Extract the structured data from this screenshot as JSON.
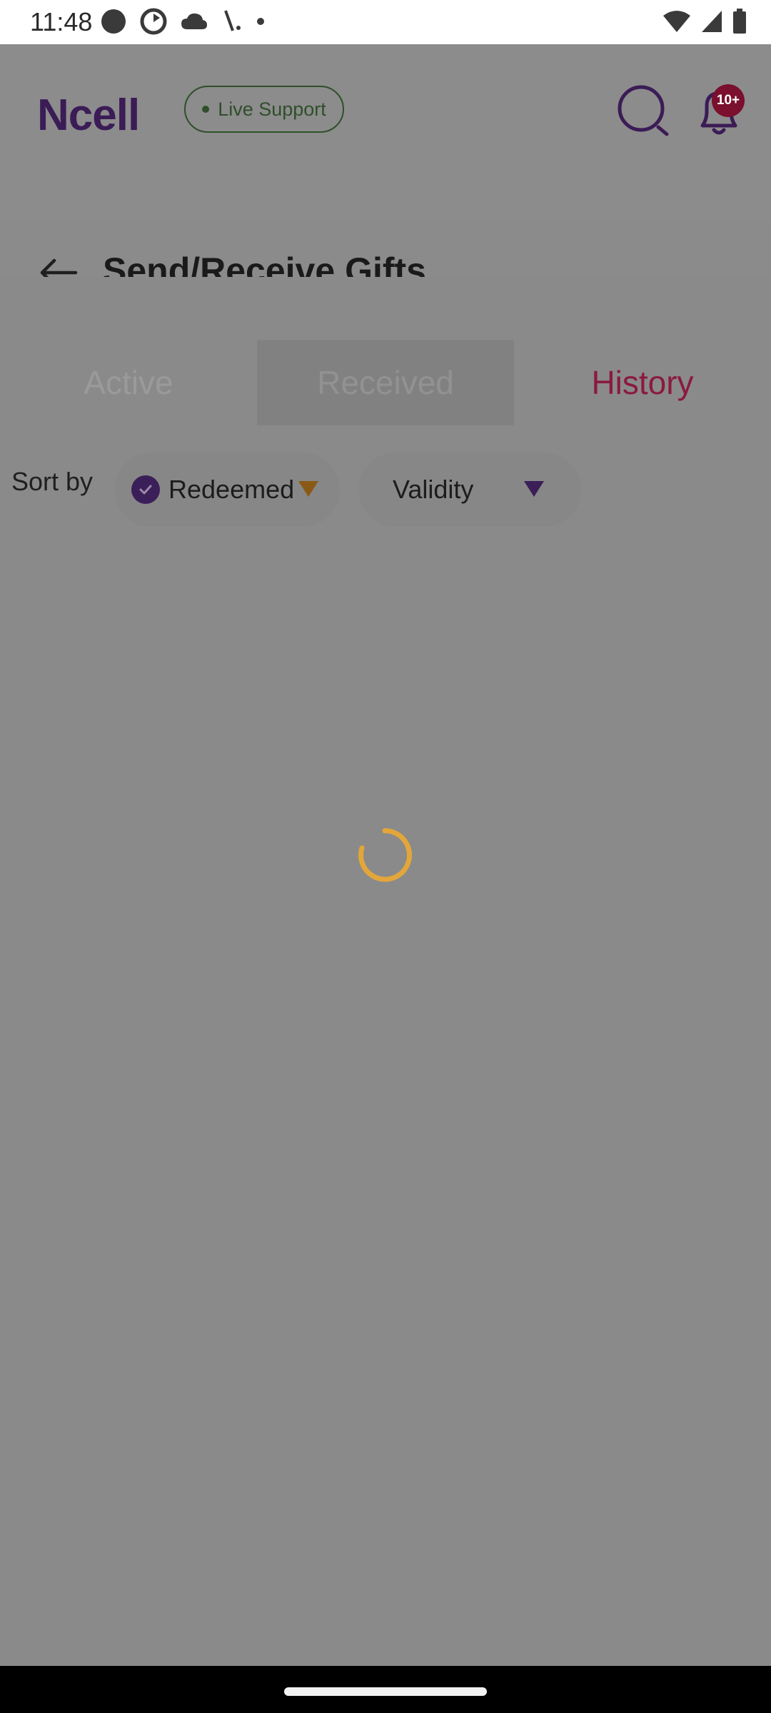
{
  "status_bar": {
    "time": "11:48",
    "left_icons": [
      "circle-icon",
      "sync-icon",
      "cloud-icon",
      "signal-slash-icon",
      "dot-icon"
    ],
    "right_icons": [
      "wifi-icon",
      "cell-signal-icon",
      "battery-icon"
    ]
  },
  "header": {
    "brand": "Ncell",
    "live_support_label": "Live Support",
    "notification_count": "10+",
    "colors": {
      "brand": "#3b1c56",
      "live_support": "#2f4f2a",
      "badge": "#7a0f2e"
    }
  },
  "page": {
    "title": "Send/Receive Gifts"
  },
  "tabs": [
    {
      "label": "Active",
      "selected": false
    },
    {
      "label": "Received",
      "selected": false
    },
    {
      "label": "History",
      "selected": true
    }
  ],
  "sort": {
    "label": "Sort by",
    "chips": [
      {
        "label": "Redeemed",
        "checked": true,
        "caret_color": "#8a5a14"
      },
      {
        "label": "Validity",
        "checked": false,
        "caret_color": "#3b1f58"
      }
    ]
  },
  "loading": {
    "visible": true,
    "spinner_color": "#e3a63a"
  },
  "colors": {
    "overlay_background": "#8b8b8b",
    "history_tab": "#8a1a3e"
  }
}
